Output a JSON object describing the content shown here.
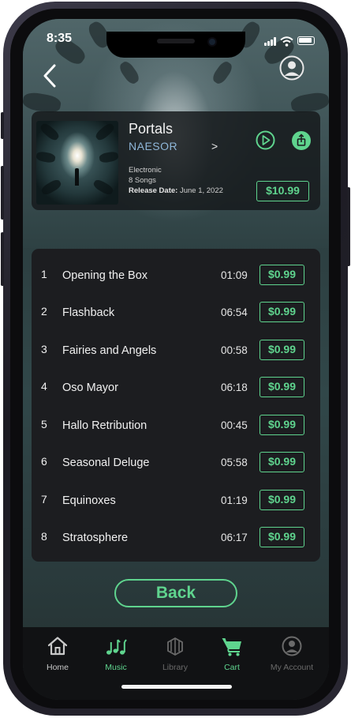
{
  "status_bar": {
    "time": "8:35"
  },
  "album": {
    "title": "Portals",
    "artist": "NAESOR",
    "artist_chevron": ">",
    "genre": "Electronic",
    "song_count": "8 Songs",
    "release_label": "Release Date:",
    "release_date": "June 1, 2022",
    "price": "$10.99"
  },
  "tracks": [
    {
      "num": "1",
      "title": "Opening the Box",
      "duration": "01:09",
      "price": "$0.99"
    },
    {
      "num": "2",
      "title": "Flashback",
      "duration": "06:54",
      "price": "$0.99"
    },
    {
      "num": "3",
      "title": "Fairies and Angels",
      "duration": "00:58",
      "price": "$0.99"
    },
    {
      "num": "4",
      "title": "Oso Mayor",
      "duration": "06:18",
      "price": "$0.99"
    },
    {
      "num": "5",
      "title": "Hallo Retribution",
      "duration": "00:45",
      "price": "$0.99"
    },
    {
      "num": "6",
      "title": "Seasonal Deluge",
      "duration": "05:58",
      "price": "$0.99"
    },
    {
      "num": "7",
      "title": "Equinoxes",
      "duration": "01:19",
      "price": "$0.99"
    },
    {
      "num": "8",
      "title": "Stratosphere",
      "duration": "06:17",
      "price": "$0.99"
    }
  ],
  "back_button": {
    "label": "Back"
  },
  "tabs": [
    {
      "label": "Home",
      "icon": "home-icon",
      "color": "#c9c9c9"
    },
    {
      "label": "Music",
      "icon": "music-notes-icon",
      "color": "#5fd48e"
    },
    {
      "label": "Library",
      "icon": "library-icon",
      "color": "#6a6a6a"
    },
    {
      "label": "Cart",
      "icon": "cart-icon",
      "color": "#5fd48e"
    },
    {
      "label": "My Account",
      "icon": "account-icon",
      "color": "#6a6a6a"
    }
  ],
  "colors": {
    "accent": "#5fd48e",
    "artist": "#8fb7d9",
    "card": "#1c1d20"
  }
}
